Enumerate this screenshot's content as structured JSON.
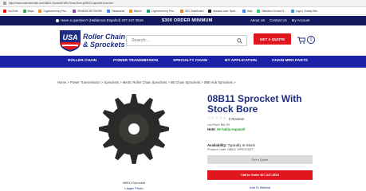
{
  "browser": {
    "url": "https://www.usarollerchain.com/08B11-Sprocket-With-Stock-Bore-p/08b11-sprocket-bore.htm",
    "bookmarks": [
      {
        "label": "YouTube",
        "color": "#ff0000"
      },
      {
        "label": "Maps",
        "color": "#34a853"
      },
      {
        "label": "Cryptocurrency Pric...",
        "color": "#f7931a"
      },
      {
        "label": "GENESIS NETWORK",
        "color": "#8e44ad"
      },
      {
        "label": "Passwords",
        "color": "#4285f4"
      },
      {
        "label": "Bitcoin",
        "color": "#f7931a"
      },
      {
        "label": "Cryptocurrency Pric...",
        "color": "#16a085"
      },
      {
        "label": "SEO Dashboard",
        "color": "#e67e22"
      },
      {
        "label": "Amazon.com: Sprin...",
        "color": "#222222"
      },
      {
        "label": "Help",
        "color": "#4285f4"
      },
      {
        "label": "Selection Ground S...",
        "color": "#2ecc71"
      },
      {
        "label": "Login | Charity Site...",
        "color": "#3498db"
      }
    ]
  },
  "promo": {
    "phone": "Have a question? (Hablamos Español) 407-347-3519",
    "minimum": "$300 ORDER MINIMUM",
    "links": [
      "About Us",
      "Contact Us",
      "My Account"
    ]
  },
  "header": {
    "logo_badge": "USA",
    "logo_line1": "Roller Chain",
    "logo_line2": "& Sprockets",
    "search_placeholder": "Search...",
    "quote_button": "GET A QUOTE",
    "cart_count": "0"
  },
  "nav": {
    "items": [
      "ROLLER CHAIN",
      "POWER TRANSMISSION",
      "SPECIALTY CHAIN",
      "BY APPLICATION",
      "CHAIN MRO PARTS"
    ]
  },
  "breadcrumb": "Home > Power Transmission > Sprockets > Metric Roller Chain Sprockets > 8B Chain Sprockets > 08B Hub Sprockets >",
  "product": {
    "image_caption": "08B11 Sprocket",
    "image_link": "Larger Photo",
    "title": "08B11 Sprocket With Stock Bore",
    "stars": "☆☆☆☆☆",
    "reviews": "0 Reviews",
    "list_price": "List Price: $61.99",
    "note_label": "Note:",
    "note_text": "Se habla espanol!",
    "availability_label": "Availability:",
    "availability_value": "Typically In-Stock",
    "product_code": "Product Code: 08B11 SPROCKET",
    "get_quote": "Get a Quote",
    "call_order": "Call to Order 407-347-3519",
    "wishlist": "Add To Wishlist"
  },
  "colors": {
    "navy": "#14195e",
    "nav_blue": "#1b21a6",
    "brand_blue": "#1c2d82",
    "red": "#e1171e",
    "green": "#1a9b2a"
  }
}
